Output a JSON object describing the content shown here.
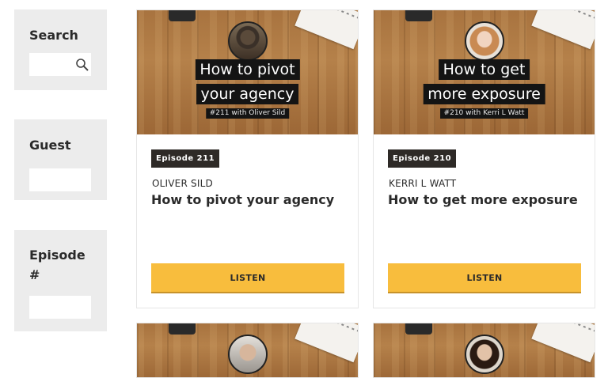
{
  "sidebar": {
    "search": {
      "label": "Search",
      "value": "",
      "icon": "search-icon"
    },
    "guest": {
      "label": "Guest",
      "value": ""
    },
    "episode": {
      "label": "Episode #",
      "value": ""
    }
  },
  "episodes": [
    {
      "thumb_line1": "How to pivot",
      "thumb_line2": "your agency",
      "thumb_sub": "#211 with Oliver Sild",
      "badge": "Episode 211",
      "guest": "OLIVER SILD",
      "title": "How to pivot your agency",
      "button": "LISTEN"
    },
    {
      "thumb_line1": "How to get",
      "thumb_line2": "more exposure",
      "thumb_sub": "#210 with Kerri L Watt",
      "badge": "Episode 210",
      "guest": "KERRI L WATT",
      "title": "How to get more exposure",
      "button": "LISTEN"
    }
  ],
  "colors": {
    "accent_button": "#f8bd3d",
    "badge_bg": "#2e2a27",
    "widget_bg": "#ececec"
  }
}
